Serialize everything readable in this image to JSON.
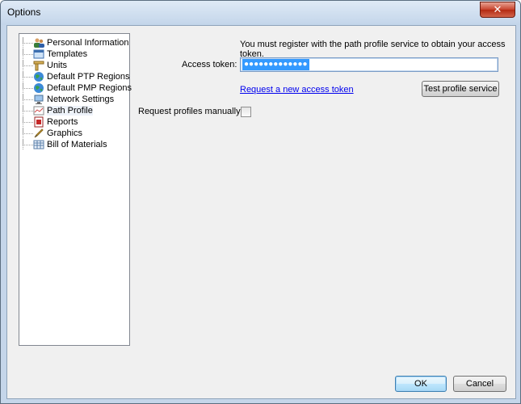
{
  "window": {
    "title": "Options",
    "close_glyph": "✕"
  },
  "tree": {
    "items": [
      {
        "label": "Personal Information",
        "icon": "people-icon"
      },
      {
        "label": "Templates",
        "icon": "template-icon"
      },
      {
        "label": "Units",
        "icon": "ruler-icon"
      },
      {
        "label": "Default PTP Regions",
        "icon": "globe-icon"
      },
      {
        "label": "Default PMP Regions",
        "icon": "globe-icon"
      },
      {
        "label": "Network Settings",
        "icon": "network-icon"
      },
      {
        "label": "Path Profile",
        "icon": "profile-chart-icon",
        "selected": true
      },
      {
        "label": "Reports",
        "icon": "pdf-icon"
      },
      {
        "label": "Graphics",
        "icon": "pencil-icon"
      },
      {
        "label": "Bill of Materials",
        "icon": "table-icon"
      }
    ]
  },
  "panel": {
    "info_text": "You must register with the path profile service to obtain your access token.",
    "access_token_label": "Access token:",
    "access_token_value": "●●●●●●●●●●●●●",
    "request_link": "Request a new access token",
    "test_button": "Test profile service",
    "manual_label": "Request profiles manually?",
    "manual_checked": false
  },
  "footer": {
    "ok": "OK",
    "cancel": "Cancel"
  },
  "colors": {
    "selection": "#3399ff",
    "link": "#0000ee",
    "titlebar": "#c5d6ea"
  }
}
